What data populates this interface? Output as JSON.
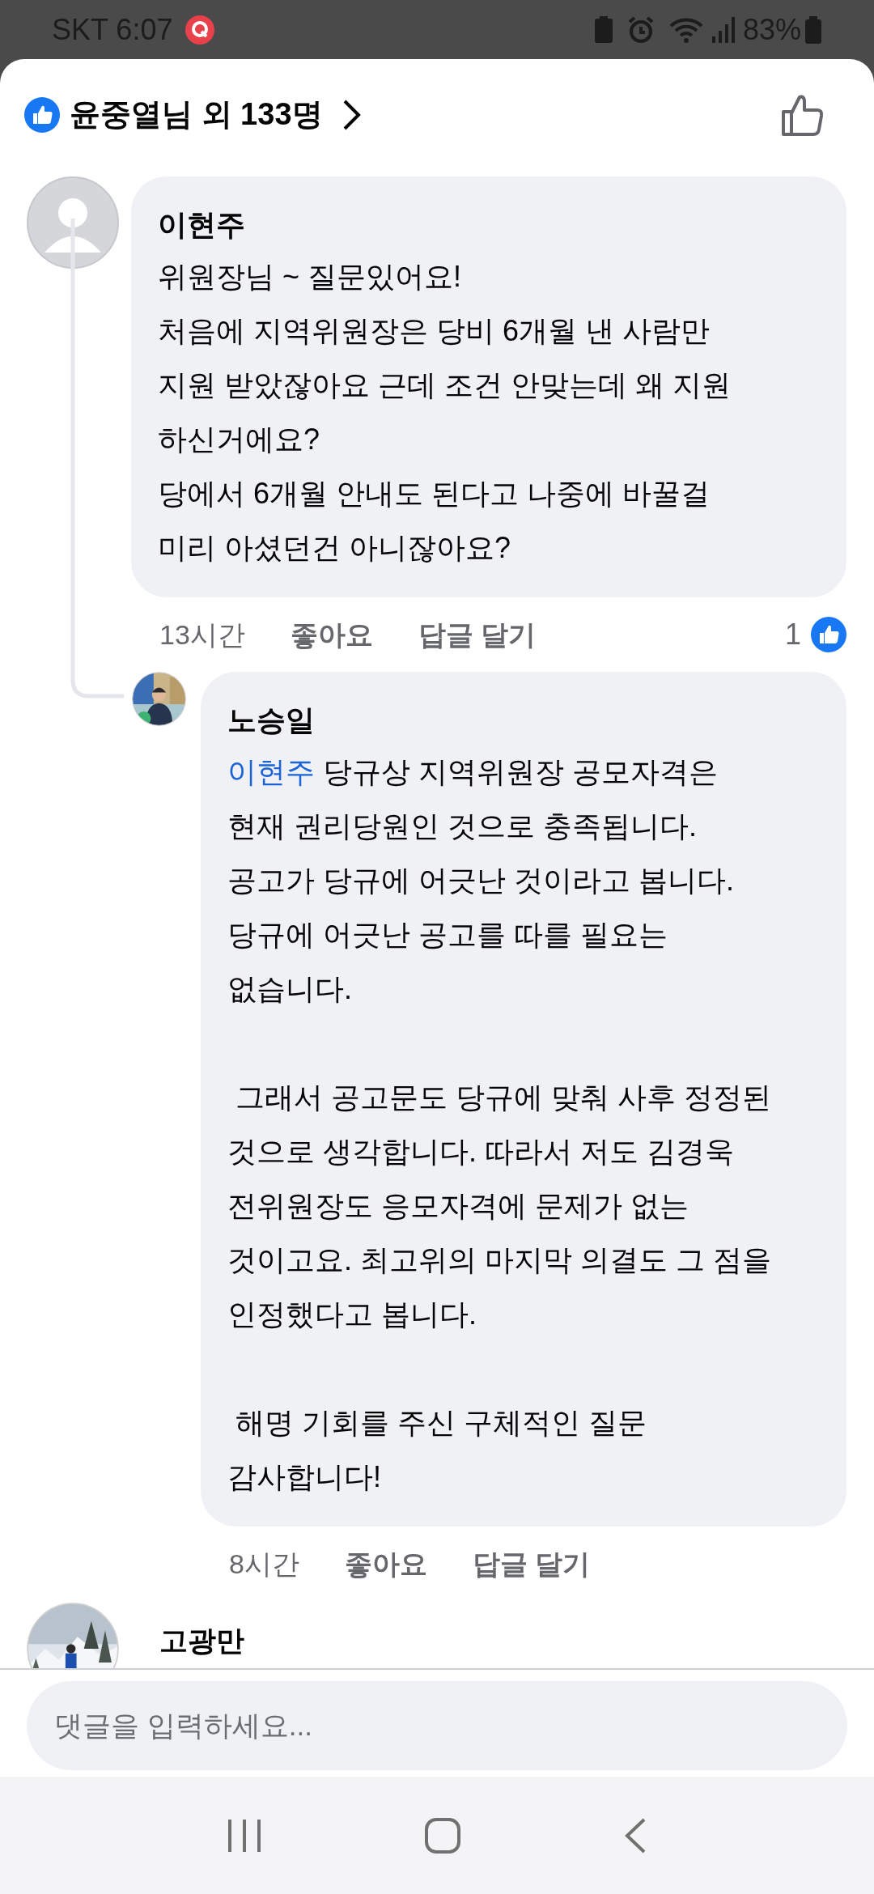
{
  "status_bar": {
    "carrier_time": "SKT 6:07",
    "battery": "83%"
  },
  "reactions_header": {
    "text": "윤중열님 외 133명"
  },
  "comments": [
    {
      "author": "이현주",
      "avatar": {
        "kind": "default"
      },
      "body": "위원장님 ~ 질문있어요!\n처음에 지역위원장은 당비 6개월 낸 사람만\n지원 받았잖아요 근데 조건 안맞는데 왜 지원\n하신거에요?\n당에서 6개월 안내도 된다고 나중에 바꿀걸\n미리 아셨던건 아니잖아요?",
      "time": "13시간",
      "like_label": "좋아요",
      "reply_label": "답글 달기",
      "reaction_count": "1",
      "replies": [
        {
          "author": "노승일",
          "avatar": {
            "kind": "portrait"
          },
          "mention": "이현주",
          "body": " 당규상 지역위원장 공모자격은\n현재 권리당원인 것으로 충족됩니다.\n공고가 당규에 어긋난 것이라고 봅니다.\n당규에 어긋난 공고를 따를 필요는\n없습니다.\n\n 그래서 공고문도 당규에 맞춰 사후 정정된\n것으로 생각합니다. 따라서 저도 김경욱\n전위원장도 응모자격에 문제가 없는\n것이고요. 최고위의 마지막 의결도 그 점을\n인정했다고 봅니다.\n\n 해명 기회를 주신 구체적인 질문\n감사합니다!",
          "time": "8시간",
          "like_label": "좋아요",
          "reply_label": "답글 달기"
        }
      ]
    },
    {
      "author": "고광만",
      "avatar": {
        "kind": "landscape"
      }
    }
  ],
  "comment_input": {
    "placeholder": "댓글을 입력하세요..."
  }
}
